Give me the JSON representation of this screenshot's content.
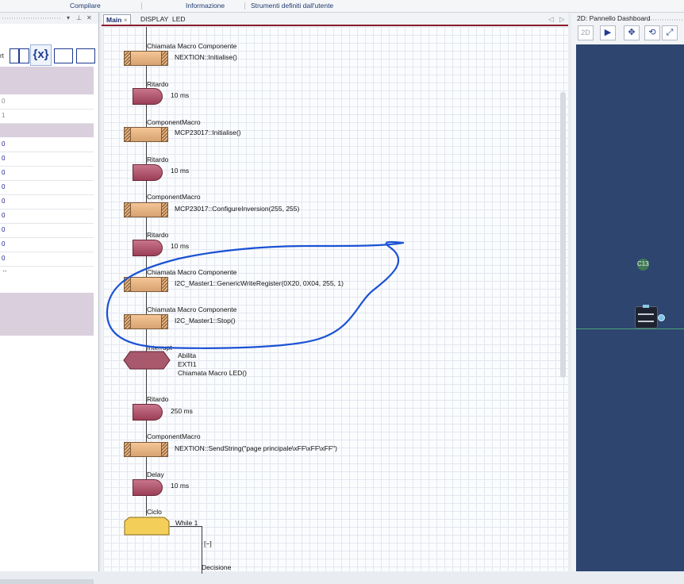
{
  "menu": {
    "compile": "Compilare",
    "info": "Informazione",
    "user_tools": "Strumenti definiti dall'utente"
  },
  "left_panel": {
    "toolbar_text": "rt",
    "variable_symbol": "{x}",
    "rows": [
      "0",
      "1",
      "0",
      "0",
      "0",
      "0",
      "0",
      "0",
      "0",
      "0",
      "0"
    ],
    "more": "↔"
  },
  "tabs": [
    {
      "label": "Main",
      "close": "×"
    },
    {
      "label": "DISPLAY"
    },
    {
      "label": "LED"
    }
  ],
  "tab_nav": {
    "prev": "◁",
    "next": "▷"
  },
  "flowchart": {
    "step1": {
      "type": "Chiamata Macro Componente",
      "text": "NEXTION::Initialise()"
    },
    "step2": {
      "type": "Ritardo",
      "text": "10 ms"
    },
    "step3": {
      "type": "ComponentMacro",
      "text": "MCP23017::Initialise()"
    },
    "step4": {
      "type": "Ritardo",
      "text": "10 ms"
    },
    "step5": {
      "type": "ComponentMacro",
      "text": "MCP23017::ConfigureInversion(255, 255)"
    },
    "step6": {
      "type": "Ritardo",
      "text": "10 ms"
    },
    "step7": {
      "type": "Chiamata Macro Componente",
      "text": "I2C_Master1::GenericWriteRegister(0X20, 0X04, 255, 1)"
    },
    "step8": {
      "type": "Chiamata Macro Componente",
      "text": "I2C_Master1::Stop()"
    },
    "step9": {
      "type": "Interrupt",
      "line1": "Abilita",
      "line2": "EXTI1",
      "line3": "Chiamata Macro LED()"
    },
    "step10": {
      "type": "Ritardo",
      "text": "250 ms"
    },
    "step11": {
      "type": "ComponentMacro",
      "text": "NEXTION::SendString(\"page principale\\xFF\\xFF\\xFF\")"
    },
    "step12": {
      "type": "Delay",
      "text": "10 ms"
    },
    "step13": {
      "type": "Ciclo",
      "text": "While 1"
    },
    "collapse": "[−]",
    "decision": "Decisione"
  },
  "right_panel": {
    "title": "2D: Pannello Dashboard",
    "tools": [
      "2D",
      "▶",
      "✥",
      "⟲",
      "⤢"
    ],
    "component_label": "C13"
  },
  "colors": {
    "tab_accent": "#8b1d2c",
    "annotation": "#1a52d4",
    "dashboard_bg": "#2e4570"
  }
}
